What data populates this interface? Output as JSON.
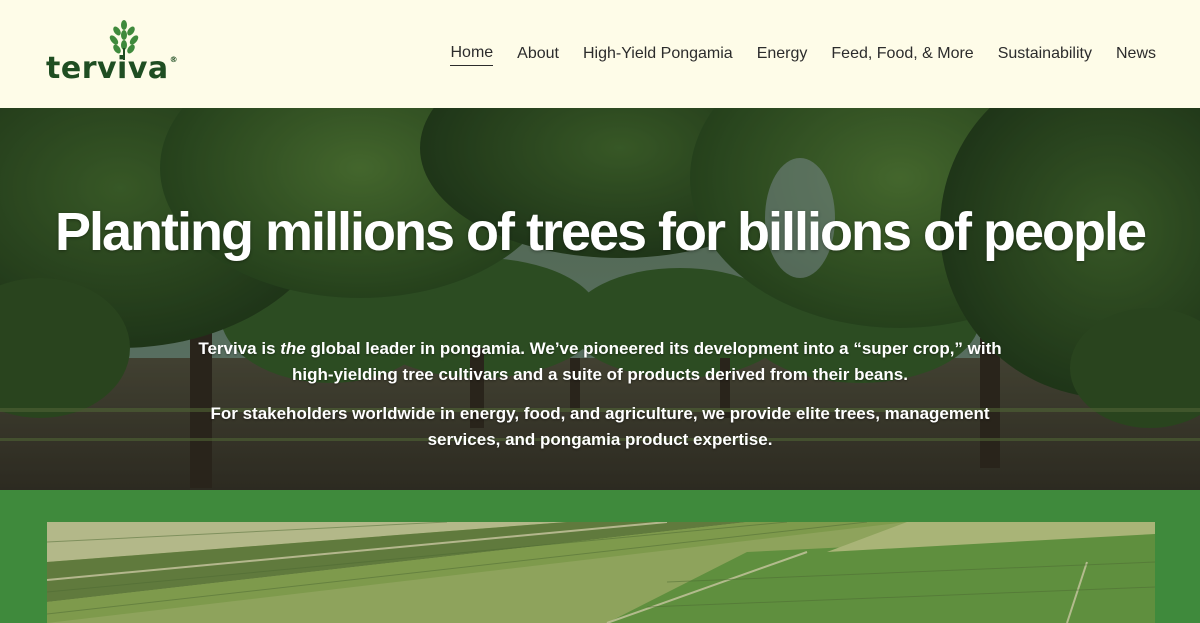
{
  "header": {
    "logo_text": "terviva",
    "logo_reg": "®",
    "nav": [
      {
        "label": "Home",
        "active": true
      },
      {
        "label": "About"
      },
      {
        "label": "High-Yield Pongamia"
      },
      {
        "label": "Energy"
      },
      {
        "label": "Feed, Food, & More"
      },
      {
        "label": "Sustainability"
      },
      {
        "label": "News"
      }
    ]
  },
  "hero": {
    "title": "Planting millions of trees for billions of people",
    "p1_pre": "Terviva is ",
    "p1_em": "the",
    "p1_post": " global leader in pongamia. We’ve pioneered its development into a “super crop,” with high-yielding tree cultivars and a suite of products derived from their beans.",
    "p2": "For stakeholders worldwide in energy, food, and agriculture, we provide elite trees, management services, and pongamia product expertise."
  },
  "colors": {
    "header_bg": "#fefce8",
    "brand_green": "#1f4e22",
    "leaf_green": "#3f8a3c",
    "band_green": "#3f8a3c",
    "nav_text": "#2c2c2c"
  },
  "icons": {
    "logo_mark": "leaf-cluster-icon"
  }
}
